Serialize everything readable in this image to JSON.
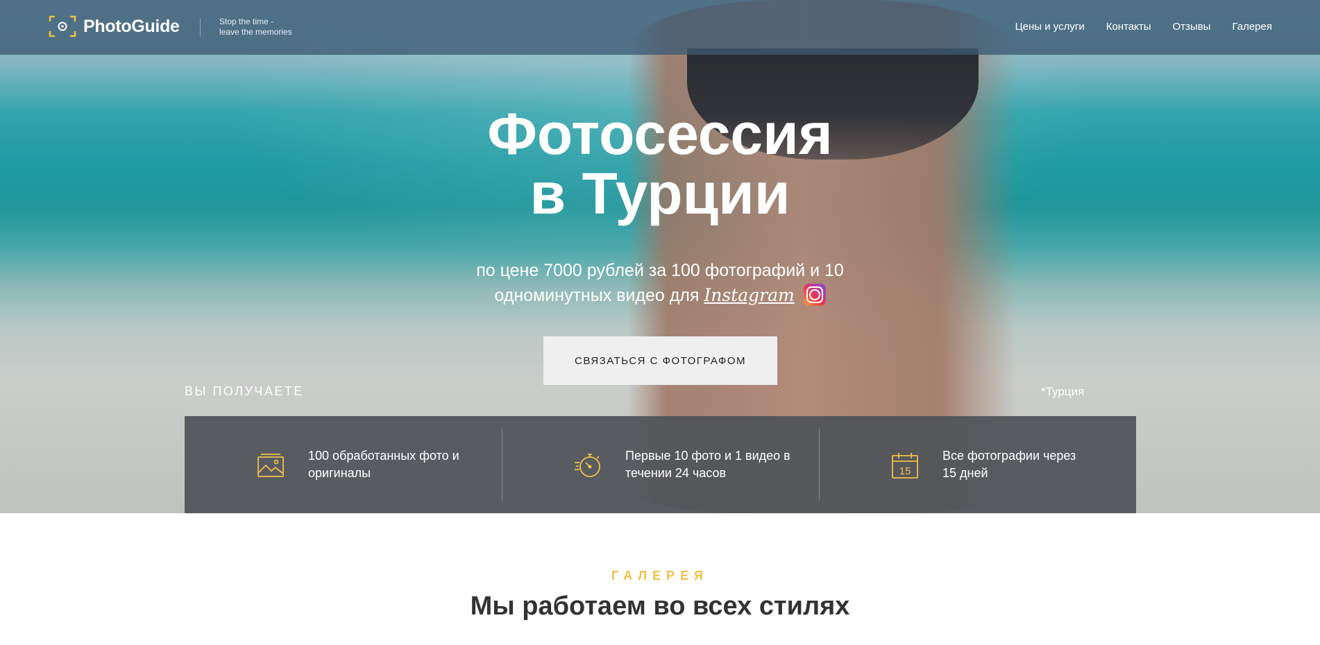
{
  "header": {
    "logo_text": "PhotoGuide",
    "tagline_line1": "Stop the time -",
    "tagline_line2": "leave the memories",
    "nav": [
      "Цены и услуги",
      "Контакты",
      "Отзывы",
      "Галерея"
    ]
  },
  "hero": {
    "title_line1": "Фотосессия",
    "title_line2": "в Турции",
    "subtitle_line1": "по цене 7000 рублей за 100 фотографий и 10",
    "subtitle_line2_prefix": "одноминутных видео для",
    "subtitle_instagram": "Instagram",
    "cta_label": "СВЯЗАТЬСЯ С ФОТОГРАФОМ",
    "you_get": "ВЫ ПОЛУЧАЕТЕ",
    "region": "*Турция"
  },
  "features": [
    {
      "icon": "image-icon",
      "line1": "100 обработанных фото и",
      "line2": "оригиналы"
    },
    {
      "icon": "stopwatch-icon",
      "line1": "Первые 10 фото и 1 видео в",
      "line2": "течении 24 часов"
    },
    {
      "icon": "calendar-icon",
      "line1": "Все фотографии через",
      "line2": "15 дней",
      "calendar_number": "15"
    }
  ],
  "gallery": {
    "label": "ГАЛЕРЕЯ",
    "title": "Мы работаем во всех стилях"
  },
  "colors": {
    "accent": "#f0c04a",
    "header_bg": "#3c5a73",
    "features_bg": "#505458"
  }
}
